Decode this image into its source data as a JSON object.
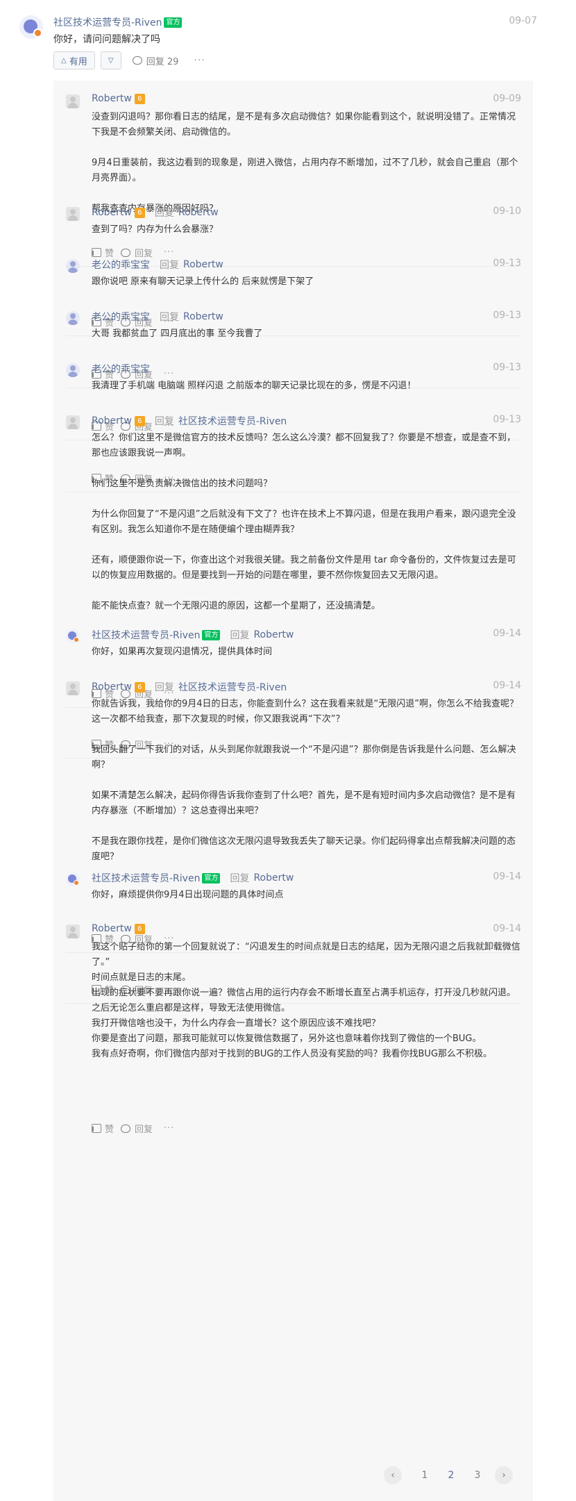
{
  "top": {
    "author": "社区技术运营专员-Riven",
    "badge": "官方",
    "date": "09-07",
    "text": "你好，请问问题解决了吗",
    "useful_label": "有用",
    "reply_label": "回复 29",
    "more": "···"
  },
  "ui": {
    "like_label": "赞",
    "reply_label": "回复",
    "reply_word": "回复",
    "more": "···",
    "official_badge": "官方",
    "level_badge": "6"
  },
  "replies": [
    {
      "author": "Robertw",
      "date": "09-09",
      "paras": [
        "没查到闪退吗？那你看日志的结尾，是不是有多次启动微信？如果你能看到这个，就说明没错了。正常情况下我是不会频繁关闭、启动微信的。",
        "9月4日重装前，我这边看到的现象是，刚进入微信，占用内存不断增加，过不了几秒，就会自己重启（那个月亮界面）。",
        "帮我查查内存暴涨的原因好吗？"
      ]
    },
    {
      "author": "Robertw",
      "reply_to": "Robertw",
      "date": "09-10",
      "paras": [
        "查到了吗？内存为什么会暴涨？"
      ]
    },
    {
      "author": "老公的乖宝宝",
      "reply_to": "Robertw",
      "date": "09-13",
      "paras": [
        "跟你说吧 原来有聊天记录上传什么的 后来就愣是下架了"
      ]
    },
    {
      "author": "老公的乖宝宝",
      "reply_to": "Robertw",
      "date": "09-13",
      "paras": [
        "大哥 我都贫血了 四月底出的事 至今我曹了"
      ]
    },
    {
      "author": "老公的乖宝宝",
      "date": "09-13",
      "paras": [
        "我清理了手机端 电脑端 照样闪退 之前版本的聊天记录比现在的多，愣是不闪退！"
      ]
    },
    {
      "author": "Robertw",
      "reply_to": "社区技术运营专员-Riven",
      "date": "09-13",
      "paras": [
        "怎么？你们这里不是微信官方的技术反馈吗？怎么这么冷漠？都不回复我了？你要是不想查，或是查不到，那也应该跟我说一声啊。",
        "你们这里不是负责解决微信出的技术问题吗？",
        "为什么你回复了“不是闪退”之后就没有下文了？也许在技术上不算闪退，但是在我用户看来，跟闪退完全没有区别。我怎么知道你不是在随便编个理由糊弄我？",
        "还有，顺便跟你说一下，你查出这个对我很关键。我之前备份文件是用 tar 命令备份的，文件恢复过去是可以的恢复应用数据的。但是要找到一开始的问题在哪里，要不然你恢复回去又无限闪退。",
        "能不能快点查？就一个无限闪退的原因，这都一个星期了，还没搞清楚。"
      ]
    },
    {
      "author": "社区技术运营专员-Riven",
      "reply_to": "Robertw",
      "date": "09-14",
      "paras": [
        "你好，如果再次复现闪退情况，提供具体时间"
      ]
    },
    {
      "author": "Robertw",
      "reply_to": "社区技术运营专员-Riven",
      "date": "09-14",
      "paras": [
        "你就告诉我，我给你的9月4日的日志，你能查到什么？这在我看来就是“无限闪退”啊，你怎么不给我查呢？这一次都不给我查，那下次复现的时候，你又跟我说再“下次”？",
        "我回头翻了一下我们的对话，从头到尾你就跟我说一个“不是闪退”？那你倒是告诉我是什么问题、怎么解决啊？",
        "如果不清楚怎么解决，起码你得告诉我你查到了什么吧？首先，是不是有短时间内多次启动微信？是不是有内存暴涨（不断增加）？这总查得出来吧？",
        "不是我在跟你找茬，是你们微信这次无限闪退导致我丢失了聊天记录。你们起码得拿出点帮我解决问题的态度吧？"
      ]
    },
    {
      "author": "社区技术运营专员-Riven",
      "reply_to": "Robertw",
      "date": "09-14",
      "paras": [
        "你好，麻烦提供你9月4日出现问题的具体时间点"
      ]
    },
    {
      "author": "Robertw",
      "date": "09-14",
      "paras": [
        "我这个贴子给你的第一个回复就说了：“闪退发生的时间点就是日志的结尾，因为无限闪退之后我就卸载微信了。”",
        "时间点就是日志的末尾。",
        "出现的症状要不要再跟你说一遍？微信占用的运行内存会不断增长直至占满手机运存，打开没几秒就闪退。之后无论怎么重启都是这样，导致无法使用微信。",
        "我打开微信啥也没干，为什么内存会一直增长？这个原因应该不难找吧？",
        "你要是查出了问题，那我可能就可以恢复微信数据了，另外这也意味着你找到了微信的一个BUG。",
        "我有点好奇啊，你们微信内部对于找到的BUG的工作人员没有奖励的吗？我看你找BUG那么不积极。"
      ]
    }
  ],
  "pager": {
    "prev": "‹",
    "pages": [
      "1",
      "2",
      "3"
    ],
    "current": "2",
    "next": "›"
  }
}
